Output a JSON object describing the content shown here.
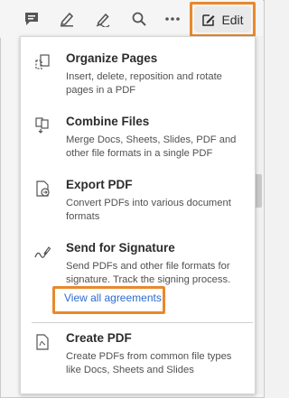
{
  "toolbar": {
    "icons": [
      "comment-icon",
      "highlight-icon",
      "draw-icon",
      "search-icon",
      "more-icon"
    ],
    "edit_label": "Edit"
  },
  "menu": {
    "items": [
      {
        "icon": "organize-pages-icon",
        "title": "Organize Pages",
        "description": "Insert, delete, reposition and rotate pages in a PDF"
      },
      {
        "icon": "combine-files-icon",
        "title": "Combine Files",
        "description": "Merge Docs, Sheets, Slides, PDF and other file formats in a single PDF"
      },
      {
        "icon": "export-pdf-icon",
        "title": "Export PDF",
        "description": "Convert PDFs into various document formats"
      },
      {
        "icon": "signature-icon",
        "title": "Send for Signature",
        "description": "Send PDFs and other file formats for signature. Track the signing process.",
        "link": "View all agreements"
      },
      {
        "icon": "create-pdf-icon",
        "title": "Create PDF",
        "description": "Create PDFs from common file types like Docs, Sheets and Slides"
      }
    ]
  },
  "colors": {
    "highlight": "#e8892b",
    "link": "#2b6bd1"
  }
}
